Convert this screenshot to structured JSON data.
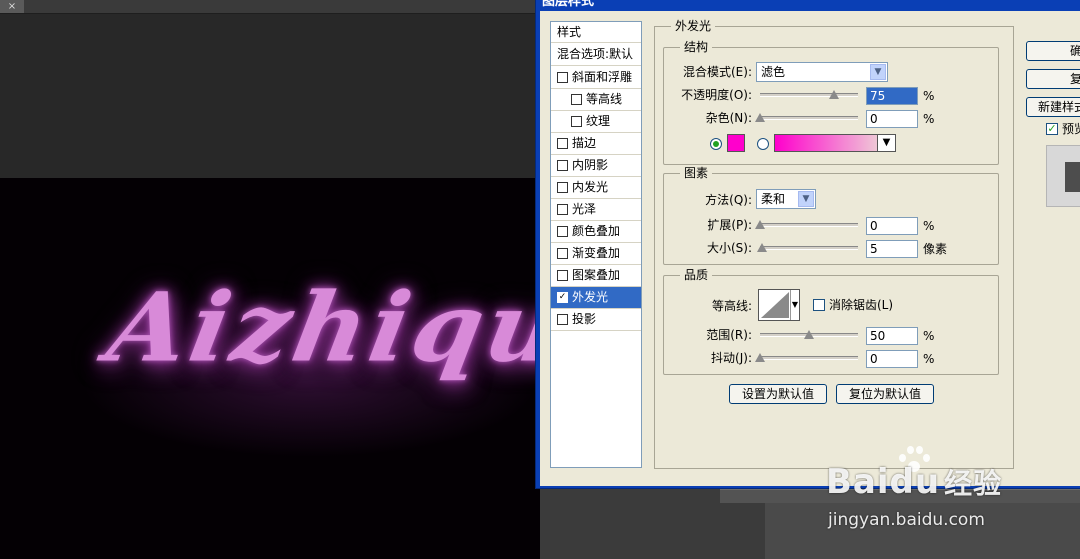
{
  "photoshop": {
    "close_tab": "×",
    "canvas_text": "Aizhiqu"
  },
  "dialog": {
    "title": "图层样式",
    "style_list": {
      "header": "样式",
      "blend_options": "混合选项:默认",
      "items": [
        {
          "label": "斜面和浮雕",
          "checked": false
        },
        {
          "label": "等高线",
          "checked": false
        },
        {
          "label": "纹理",
          "checked": false
        },
        {
          "label": "描边",
          "checked": false
        },
        {
          "label": "内阴影",
          "checked": false
        },
        {
          "label": "内发光",
          "checked": false
        },
        {
          "label": "光泽",
          "checked": false
        },
        {
          "label": "颜色叠加",
          "checked": false
        },
        {
          "label": "渐变叠加",
          "checked": false
        },
        {
          "label": "图案叠加",
          "checked": false
        },
        {
          "label": "外发光",
          "checked": true
        },
        {
          "label": "投影",
          "checked": false
        }
      ]
    },
    "outer_glow": {
      "title": "外发光",
      "structure": {
        "title": "结构",
        "blend_mode_label": "混合模式(E):",
        "blend_mode_value": "滤色",
        "opacity_label": "不透明度(O):",
        "opacity_value": "75",
        "opacity_fraction": 0.75,
        "noise_label": "杂色(N):",
        "noise_value": "0",
        "noise_fraction": 0,
        "percent": "%",
        "color_hex": "#ff00cc"
      },
      "elements": {
        "title": "图素",
        "technique_label": "方法(Q):",
        "technique_value": "柔和",
        "spread_label": "扩展(P):",
        "spread_value": "0",
        "spread_fraction": 0,
        "size_label": "大小(S):",
        "size_value": "5",
        "size_unit": "像素",
        "size_fraction": 0.02
      },
      "quality": {
        "title": "品质",
        "contour_label": "等高线:",
        "antialias_label": "消除锯齿(L)",
        "range_label": "范围(R):",
        "range_value": "50",
        "range_fraction": 0.5,
        "jitter_label": "抖动(J):",
        "jitter_value": "0",
        "jitter_fraction": 0
      },
      "make_default": "设置为默认值",
      "reset_default": "复位为默认值"
    },
    "buttons": {
      "ok": "确",
      "reset": "复",
      "new_style": "新建样式",
      "preview": "预览"
    }
  },
  "watermark": {
    "logo_a": "Bai",
    "logo_b": "du",
    "logo_c": "经验",
    "url": "jingyan.baidu.com"
  }
}
